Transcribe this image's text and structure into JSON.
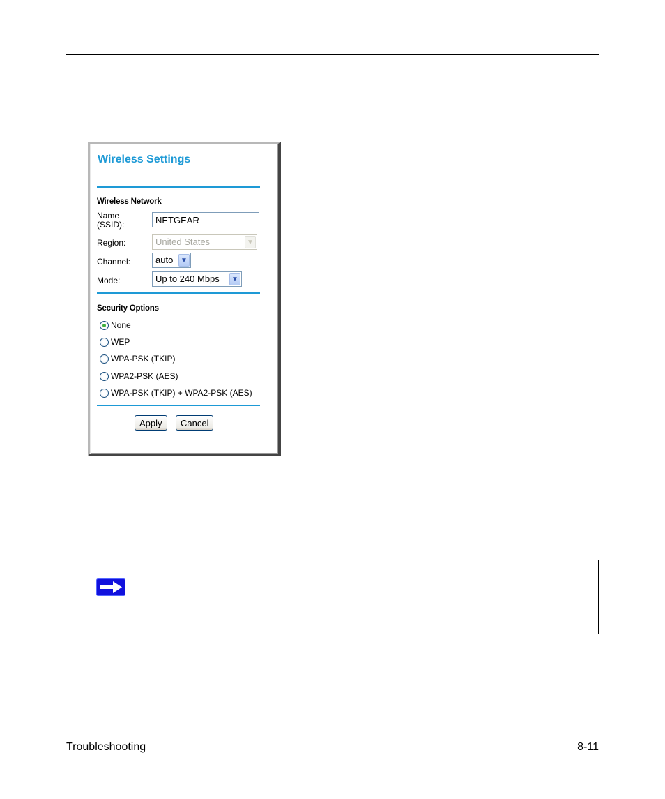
{
  "figure": {
    "title": "Wireless Settings",
    "wireless_network": {
      "heading": "Wireless Network",
      "name_label_line1": "Name",
      "name_label_line2": "(SSID):",
      "name_value": "NETGEAR",
      "region_label": "Region:",
      "region_value": "United States",
      "region_disabled": true,
      "channel_label": "Channel:",
      "channel_value": "auto",
      "mode_label": "Mode:",
      "mode_value": "Up to 240 Mbps"
    },
    "security": {
      "heading": "Security Options",
      "options": [
        {
          "label": "None",
          "checked": true
        },
        {
          "label": "WEP",
          "checked": false
        },
        {
          "label": "WPA-PSK (TKIP)",
          "checked": false
        },
        {
          "label": "WPA2-PSK (AES)",
          "checked": false
        },
        {
          "label": "WPA-PSK (TKIP) + WPA2-PSK (AES)",
          "checked": false
        }
      ]
    },
    "buttons": {
      "apply": "Apply",
      "cancel": "Cancel"
    },
    "colors": {
      "accent": "#1e9ad6"
    }
  },
  "note": {
    "icon": "right-arrow-icon",
    "text": ""
  },
  "footer": {
    "section": "Troubleshooting",
    "page": "8-11"
  }
}
